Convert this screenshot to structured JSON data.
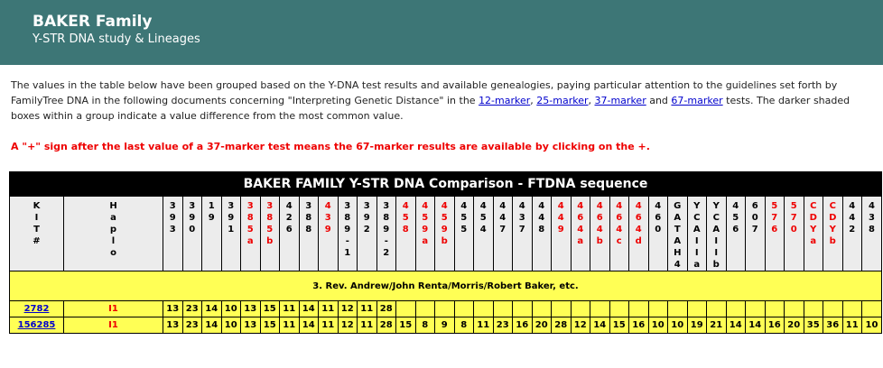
{
  "header": {
    "title": "BAKER Family",
    "subtitle": "Y-STR DNA study & Lineages"
  },
  "intro": {
    "p1": "The values in the table below have been grouped based on the Y-DNA test results and available genealogies, paying particular attention to the guidelines set forth by FamilyTree DNA in the following documents concerning \"Interpreting Genetic Distance\" in the ",
    "link12": "12-marker",
    "sep1": ", ",
    "link25": "25-marker",
    "sep2": ", ",
    "link37": "37-marker",
    "and": " and ",
    "link67": "67-marker",
    "p2": " tests. The darker shaded boxes within a group indicate a value difference from the most common value."
  },
  "note": "A \"+\" sign after the last value of a 37-marker test means the 67-marker results are available by clicking on the +.",
  "table": {
    "title": "BAKER FAMILY Y-STR DNA Comparison - FTDNA sequence",
    "kit_header": "KIT#",
    "haplo_header": "Haplo",
    "columns": [
      {
        "label": "393",
        "red": false
      },
      {
        "label": "390",
        "red": false
      },
      {
        "label": "19",
        "red": false
      },
      {
        "label": "391",
        "red": false
      },
      {
        "label": "385a",
        "red": true
      },
      {
        "label": "385b",
        "red": true
      },
      {
        "label": "426",
        "red": false
      },
      {
        "label": "388",
        "red": false
      },
      {
        "label": "439",
        "red": true
      },
      {
        "label": "389-1",
        "red": false
      },
      {
        "label": "392",
        "red": false
      },
      {
        "label": "389-2",
        "red": false
      },
      {
        "label": "458",
        "red": true
      },
      {
        "label": "459a",
        "red": true
      },
      {
        "label": "459b",
        "red": true
      },
      {
        "label": "455",
        "red": false
      },
      {
        "label": "454",
        "red": false
      },
      {
        "label": "447",
        "red": false
      },
      {
        "label": "437",
        "red": false
      },
      {
        "label": "448",
        "red": false
      },
      {
        "label": "449",
        "red": true
      },
      {
        "label": "464a",
        "red": true
      },
      {
        "label": "464b",
        "red": true
      },
      {
        "label": "464c",
        "red": true
      },
      {
        "label": "464d",
        "red": true
      },
      {
        "label": "460",
        "red": false
      },
      {
        "label": "GATAH4",
        "red": false
      },
      {
        "label": "YCAIIa",
        "red": false
      },
      {
        "label": "YCAIIb",
        "red": false
      },
      {
        "label": "456",
        "red": false
      },
      {
        "label": "607",
        "red": false
      },
      {
        "label": "576",
        "red": true
      },
      {
        "label": "570",
        "red": true
      },
      {
        "label": "CDYa",
        "red": true
      },
      {
        "label": "CDYb",
        "red": true
      },
      {
        "label": "442",
        "red": false
      },
      {
        "label": "438",
        "red": false
      }
    ],
    "group_label": "3. Rev. Andrew/John Renta/Morris/Robert Baker, etc.",
    "rows": [
      {
        "kit": "2782",
        "haplo": "I1",
        "values": [
          "13",
          "23",
          "14",
          "10",
          "13",
          "15",
          "11",
          "14",
          "11",
          "12",
          "11",
          "28"
        ]
      },
      {
        "kit": "156285",
        "haplo": "I1",
        "values": [
          "13",
          "23",
          "14",
          "10",
          "13",
          "15",
          "11",
          "14",
          "11",
          "12",
          "11",
          "28",
          "15",
          "8",
          "9",
          "8",
          "11",
          "23",
          "16",
          "20",
          "28",
          "12",
          "14",
          "15",
          "16",
          "10",
          "10",
          "19",
          "21",
          "14",
          "14",
          "16",
          "20",
          "35",
          "36",
          "11",
          "10"
        ]
      }
    ]
  }
}
